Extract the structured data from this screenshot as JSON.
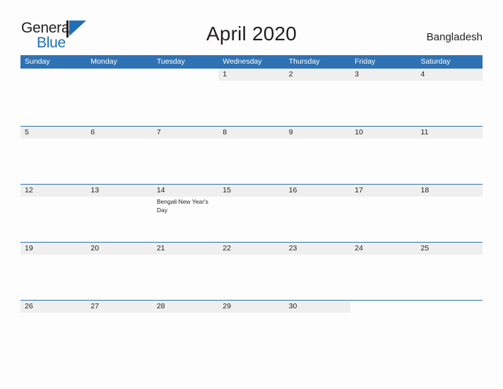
{
  "logo": {
    "word_one": "General",
    "word_two": "Blue",
    "mark": "triangle-flag-mark",
    "accent_color": "#1f6fb5",
    "text_color": "#231f20"
  },
  "header": {
    "title": "April 2020",
    "country": "Bangladesh"
  },
  "theme": {
    "header_blue": "#2f72b4",
    "row_band_gray": "#efeff0",
    "page_background": "#fdfdfd",
    "text": "#231f20"
  },
  "calendar": {
    "day_headers": [
      "Sunday",
      "Monday",
      "Tuesday",
      "Wednesday",
      "Thursday",
      "Friday",
      "Saturday"
    ],
    "weeks": [
      {
        "days": [
          {
            "date": "",
            "event": ""
          },
          {
            "date": "",
            "event": ""
          },
          {
            "date": "",
            "event": ""
          },
          {
            "date": "1",
            "event": ""
          },
          {
            "date": "2",
            "event": ""
          },
          {
            "date": "3",
            "event": ""
          },
          {
            "date": "4",
            "event": ""
          }
        ]
      },
      {
        "days": [
          {
            "date": "5",
            "event": ""
          },
          {
            "date": "6",
            "event": ""
          },
          {
            "date": "7",
            "event": ""
          },
          {
            "date": "8",
            "event": ""
          },
          {
            "date": "9",
            "event": ""
          },
          {
            "date": "10",
            "event": ""
          },
          {
            "date": "11",
            "event": ""
          }
        ]
      },
      {
        "days": [
          {
            "date": "12",
            "event": ""
          },
          {
            "date": "13",
            "event": ""
          },
          {
            "date": "14",
            "event": "Bengali New Year's Day"
          },
          {
            "date": "15",
            "event": ""
          },
          {
            "date": "16",
            "event": ""
          },
          {
            "date": "17",
            "event": ""
          },
          {
            "date": "18",
            "event": ""
          }
        ]
      },
      {
        "days": [
          {
            "date": "19",
            "event": ""
          },
          {
            "date": "20",
            "event": ""
          },
          {
            "date": "21",
            "event": ""
          },
          {
            "date": "22",
            "event": ""
          },
          {
            "date": "23",
            "event": ""
          },
          {
            "date": "24",
            "event": ""
          },
          {
            "date": "25",
            "event": ""
          }
        ]
      },
      {
        "days": [
          {
            "date": "26",
            "event": ""
          },
          {
            "date": "27",
            "event": ""
          },
          {
            "date": "28",
            "event": ""
          },
          {
            "date": "29",
            "event": ""
          },
          {
            "date": "30",
            "event": ""
          },
          {
            "date": "",
            "event": ""
          },
          {
            "date": "",
            "event": ""
          }
        ]
      }
    ]
  }
}
